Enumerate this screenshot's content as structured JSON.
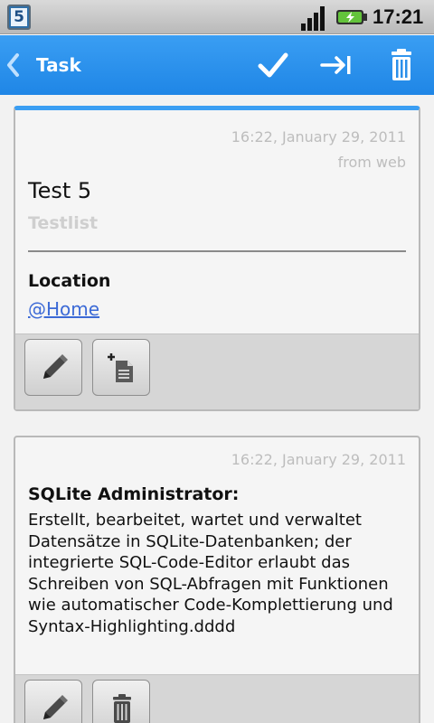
{
  "status_bar": {
    "badge": "5",
    "time": "17:21"
  },
  "action_bar": {
    "title": "Task",
    "icons": [
      "back-chevron-icon",
      "check-icon",
      "move-next-icon",
      "trash-icon"
    ]
  },
  "task_card": {
    "date": "16:22, January 29, 2011",
    "source": "from web",
    "title": "Test 5",
    "list": "Testlist",
    "location_label": "Location",
    "location_value": "@Home",
    "buttons": [
      "edit-icon",
      "add-note-icon"
    ]
  },
  "note_card": {
    "date": "16:22, January 29, 2011",
    "title": "SQLite Administrator:",
    "body": "Erstellt, bearbeitet, wartet und verwaltet Datensätze in SQLite-Datenbanken; der integrierte SQL-Code-Editor erlaubt das Schreiben von SQL-Abfragen mit Funktionen wie automatischer Code-Komplettierung und Syntax-Highlighting.dddd",
    "buttons": [
      "edit-icon",
      "trash-icon"
    ]
  },
  "colors": {
    "accent": "#3a9ef3",
    "link": "#3c6ad6",
    "muted_text": "#bdbdbd"
  }
}
